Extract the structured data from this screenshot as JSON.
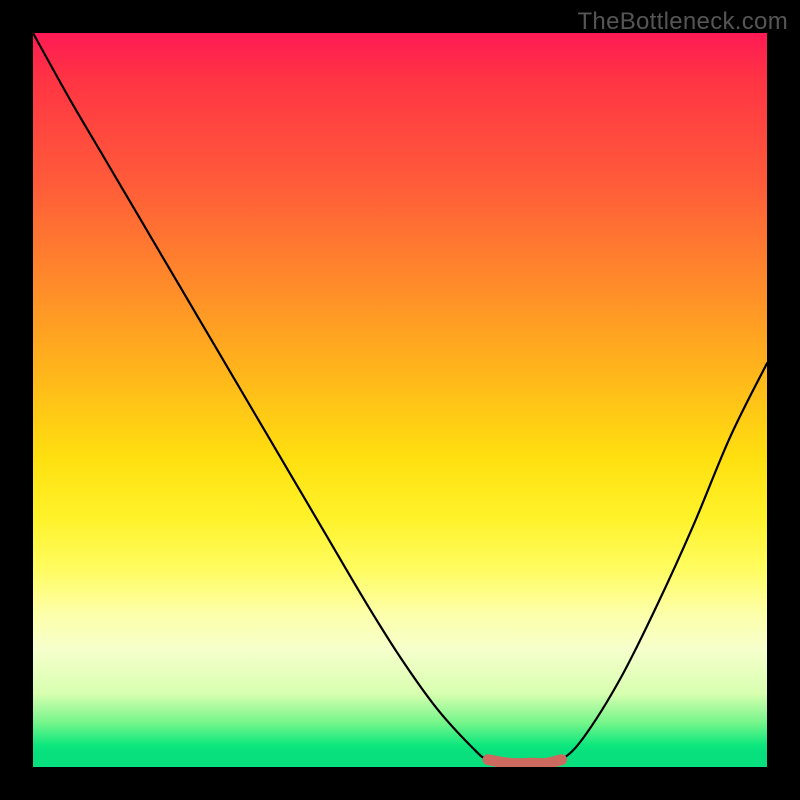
{
  "watermark": "TheBottleneck.com",
  "chart_data": {
    "type": "line",
    "title": "",
    "xlabel": "",
    "ylabel": "",
    "xlim": [
      0,
      100
    ],
    "ylim": [
      0,
      100
    ],
    "series": [
      {
        "name": "bottleneck-curve",
        "x": [
          0,
          5,
          10,
          15,
          20,
          25,
          30,
          35,
          40,
          45,
          50,
          55,
          60,
          62,
          65,
          70,
          72,
          75,
          80,
          85,
          90,
          95,
          100
        ],
        "y": [
          100,
          91,
          82.5,
          74,
          65.5,
          57,
          48.5,
          40,
          31.5,
          23,
          15,
          8,
          2.5,
          1,
          0.5,
          0.5,
          1,
          4,
          12,
          22,
          33,
          45,
          55
        ]
      },
      {
        "name": "optimal-zone",
        "x": [
          62,
          65,
          68,
          70,
          72
        ],
        "y": [
          1,
          0.5,
          0.5,
          0.5,
          1
        ]
      }
    ],
    "colors": {
      "curve": "#000000",
      "optimal_zone": "#cc6a5f",
      "gradient_top": "#ff1a55",
      "gradient_bottom": "#08e07d"
    }
  }
}
